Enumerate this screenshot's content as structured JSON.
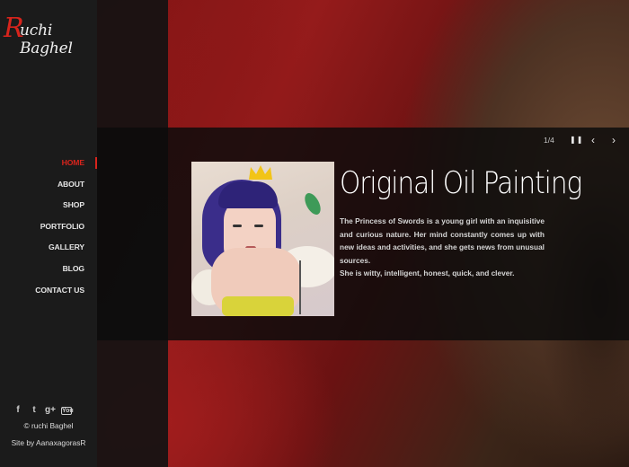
{
  "site": {
    "logo_text": "ruchi Baghel",
    "logo_initial": "R",
    "logo_rest": "uchi Baghel"
  },
  "nav": {
    "items": [
      {
        "label": "HOME",
        "active": true
      },
      {
        "label": "ABOUT"
      },
      {
        "label": "SHOP"
      },
      {
        "label": "PORTFOLIO"
      },
      {
        "label": "GALLERY"
      },
      {
        "label": "BLOG"
      },
      {
        "label": "CONTACT US"
      }
    ]
  },
  "social": {
    "icons": [
      {
        "name": "facebook-icon",
        "glyph": "f"
      },
      {
        "name": "twitter-icon",
        "glyph": "t"
      },
      {
        "name": "google-plus-icon",
        "glyph": "g+"
      },
      {
        "name": "youtube-icon",
        "glyph": "You"
      }
    ]
  },
  "footer": {
    "copyright": "© ruchi Baghel",
    "credit": "Site by AanaxagorasR"
  },
  "slider": {
    "counter": "1/4",
    "pause_glyph": "❚❚",
    "prev_glyph": "‹",
    "next_glyph": "›",
    "title": "Original Oil Painting",
    "description_1": "The Princess of Swords is a young girl with an inquisitive and curious nature. Her mind constantly comes up with new ideas and activities, and she gets news from unusual sources.",
    "description_2": "She is witty, intelligent, honest, quick, and clever."
  },
  "colors": {
    "accent": "#d8241c",
    "sidebar": "#1b1b1b"
  }
}
